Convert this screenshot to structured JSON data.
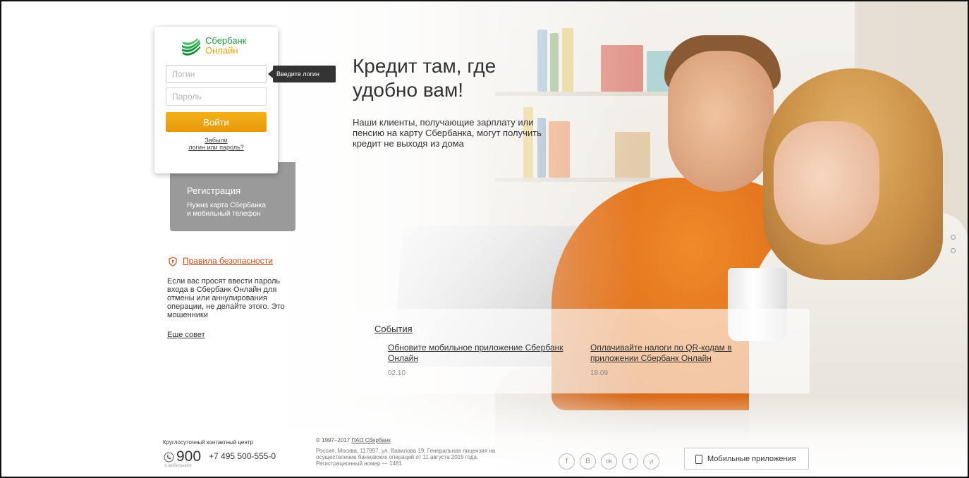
{
  "colors": {
    "brand_green": "#1f9a3e",
    "brand_orange": "#f0a30a",
    "button_orange": "#f0a30a",
    "link_red": "#d14a16",
    "registration_gray": "#9a9a9a"
  },
  "login_card": {
    "logo": {
      "line1": "Сбербанк",
      "line2": "Онлайн",
      "icon": "sberbank-logo-icon"
    },
    "login_placeholder": "Логин",
    "login_value": "",
    "password_placeholder": "Пароль",
    "password_value": "",
    "submit_label": "Войти",
    "forgot_line1": "Забыли",
    "forgot_line2": "логин или пароль?",
    "tooltip": "Введите логин"
  },
  "registration": {
    "title": "Регистрация",
    "line1": "Нужна карта Сбербанка",
    "line2": "и мобильный телефон"
  },
  "security": {
    "icon": "shield-icon",
    "link": "Правила безопасности",
    "text": "Если вас просят ввести пароль входа в Сбербанк Онлайн для отмены или аннулирования операции, не делайте этого. Это мошенники",
    "more": "Еще совет"
  },
  "hero": {
    "title": "Кредит там, где удобно вам!",
    "text": "Наши клиенты, получающие зарплату или пенсию на карту Сбербанка, могут получить кредит не выходя из дома"
  },
  "events": {
    "title": "События",
    "items": [
      {
        "title": "Обновите мобильное приложение Сбербанк Онлайн",
        "date": "02.10"
      },
      {
        "title": "Оплачивайте налоги по QR-кодам в приложении Сбербанк Онлайн",
        "date": "18.09"
      }
    ]
  },
  "slider": {
    "count": 2
  },
  "footer": {
    "contact_label": "Круглосуточный контактный центр",
    "phone_icon": "phone-icon",
    "short_number": "900",
    "short_note": "с мобильного",
    "long_number": "+7 495 500-555-0",
    "copyright": "© 1997–2017",
    "copyright_link": "ПАО Сбербанк",
    "address": "Россия, Москва, 117997, ул. Вавилова 19. Генеральная лицензия на осуществление банковских операций от 11 августа 2015 года. Регистрационный номер — 1481.",
    "social": [
      {
        "icon": "facebook-icon",
        "glyph": "f"
      },
      {
        "icon": "vkontakte-icon",
        "glyph": "B"
      },
      {
        "icon": "odnoklassniki-icon",
        "glyph": "ok"
      },
      {
        "icon": "twitter-icon",
        "glyph": "t"
      },
      {
        "icon": "youtube-icon",
        "glyph": "yt"
      }
    ],
    "mobile_apps_label": "Мобильные   приложения",
    "mobile_icon": "smartphone-icon"
  }
}
